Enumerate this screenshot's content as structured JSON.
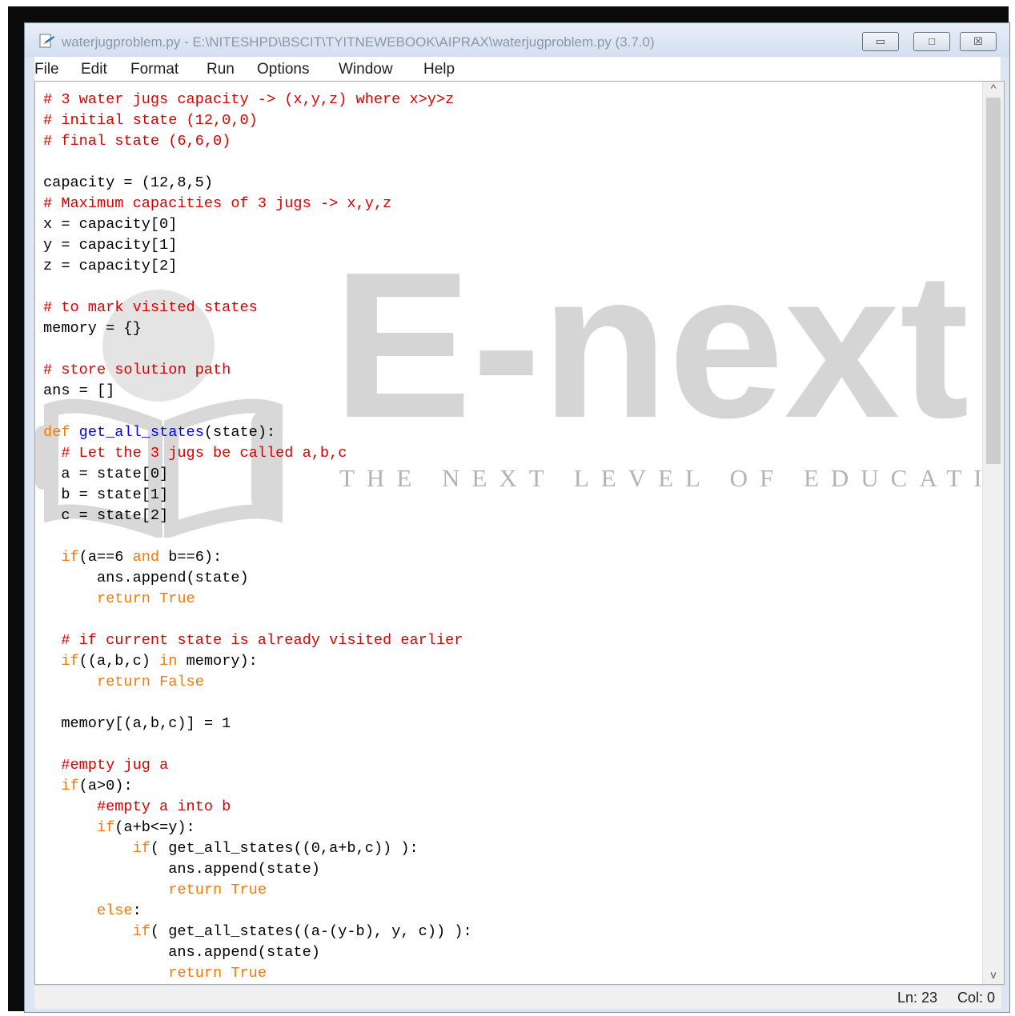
{
  "window": {
    "title": "waterjugproblem.py - E:\\NITESHPD\\BSCIT\\TYITNEWEBOOK\\AIPRAX\\waterjugproblem.py (3.7.0)",
    "controls": {
      "minimize": "▭",
      "maximize": "□",
      "close": "☒"
    }
  },
  "menu": [
    "File",
    "Edit",
    "Format",
    "Run",
    "Options",
    "Window",
    "Help"
  ],
  "editor": {
    "language": "python",
    "lines": [
      "# 3 water jugs capacity -> (x,y,z) where x>y>z",
      "# initial state (12,0,0)",
      "# final state (6,6,0)",
      "",
      "capacity = (12,8,5)",
      "# Maximum capacities of 3 jugs -> x,y,z",
      "x = capacity[0]",
      "y = capacity[1]",
      "z = capacity[2]",
      "",
      "# to mark visited states",
      "memory = {}",
      "",
      "# store solution path",
      "ans = []",
      "",
      "def get_all_states(state):",
      "  # Let the 3 jugs be called a,b,c",
      "  a = state[0]",
      "  b = state[1]",
      "  c = state[2]",
      "",
      "  if(a==6 and b==6):",
      "      ans.append(state)",
      "      return True",
      "",
      "  # if current state is already visited earlier",
      "  if((a,b,c) in memory):",
      "      return False",
      "",
      "  memory[(a,b,c)] = 1",
      "",
      "  #empty jug a",
      "  if(a>0):",
      "      #empty a into b",
      "      if(a+b<=y):",
      "          if( get_all_states((0,a+b,c)) ):",
      "              ans.append(state)",
      "              return True",
      "      else:",
      "          if( get_all_states((a-(y-b), y, c)) ):",
      "              ans.append(state)",
      "              return True"
    ]
  },
  "watermark": {
    "brand": "E-next",
    "tagline": "THE NEXT LEVEL OF EDUCATION"
  },
  "status": {
    "line": "Ln: 23",
    "col": "Col: 0"
  },
  "colors": {
    "comment": "#dd0000",
    "keyword": "#ff7700",
    "definition": "#0000ff",
    "text": "#000000"
  }
}
